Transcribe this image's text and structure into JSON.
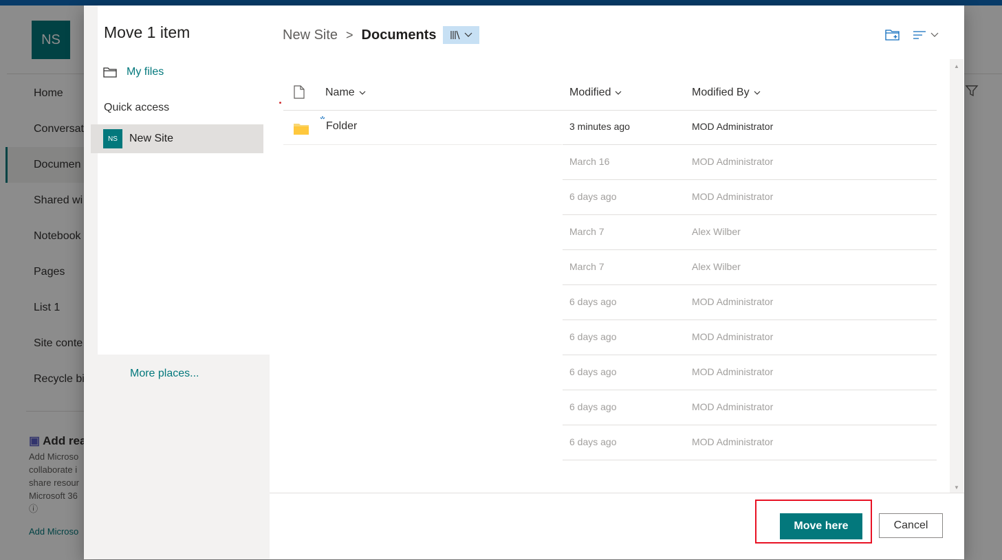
{
  "background": {
    "site_logo": "NS",
    "nav_items": [
      "Home",
      "Conversat",
      "Documen",
      "Shared wi",
      "Notebook",
      "Pages",
      "List 1",
      "Site conte",
      "Recycle bi"
    ],
    "active_nav_index": 2,
    "teams_card": {
      "title": "Add rea",
      "lines": [
        "Add Microso",
        "collaborate i",
        "share resour",
        "Microsoft 36"
      ],
      "link": "Add Microso"
    },
    "right_icons": [
      "filter-icon"
    ]
  },
  "dialog": {
    "title": "Move 1 item",
    "my_files_label": "My files",
    "quick_access_label": "Quick access",
    "site": {
      "badge": "NS",
      "name": "New Site"
    },
    "more_places_label": "More places...",
    "breadcrumb": {
      "root": "New Site",
      "separator": ">",
      "current": "Documents"
    },
    "columns": {
      "name": "Name",
      "modified": "Modified",
      "modified_by": "Modified By"
    },
    "rows": [
      {
        "name": "Folder",
        "modified": "3 minutes ago",
        "modified_by": "MOD Administrator"
      },
      {
        "name": "",
        "modified": "March 16",
        "modified_by": "MOD Administrator"
      },
      {
        "name": "",
        "modified": "6 days ago",
        "modified_by": "MOD Administrator"
      },
      {
        "name": "",
        "modified": "March 7",
        "modified_by": "Alex Wilber"
      },
      {
        "name": "",
        "modified": "March 7",
        "modified_by": "Alex Wilber"
      },
      {
        "name": "",
        "modified": "6 days ago",
        "modified_by": "MOD Administrator"
      },
      {
        "name": "",
        "modified": "6 days ago",
        "modified_by": "MOD Administrator"
      },
      {
        "name": "",
        "modified": "6 days ago",
        "modified_by": "MOD Administrator"
      },
      {
        "name": "",
        "modified": "6 days ago",
        "modified_by": "MOD Administrator"
      },
      {
        "name": "",
        "modified": "6 days ago",
        "modified_by": "MOD Administrator"
      }
    ],
    "move_button": "Move here",
    "cancel_button": "Cancel",
    "accent_color": "#03787c"
  }
}
